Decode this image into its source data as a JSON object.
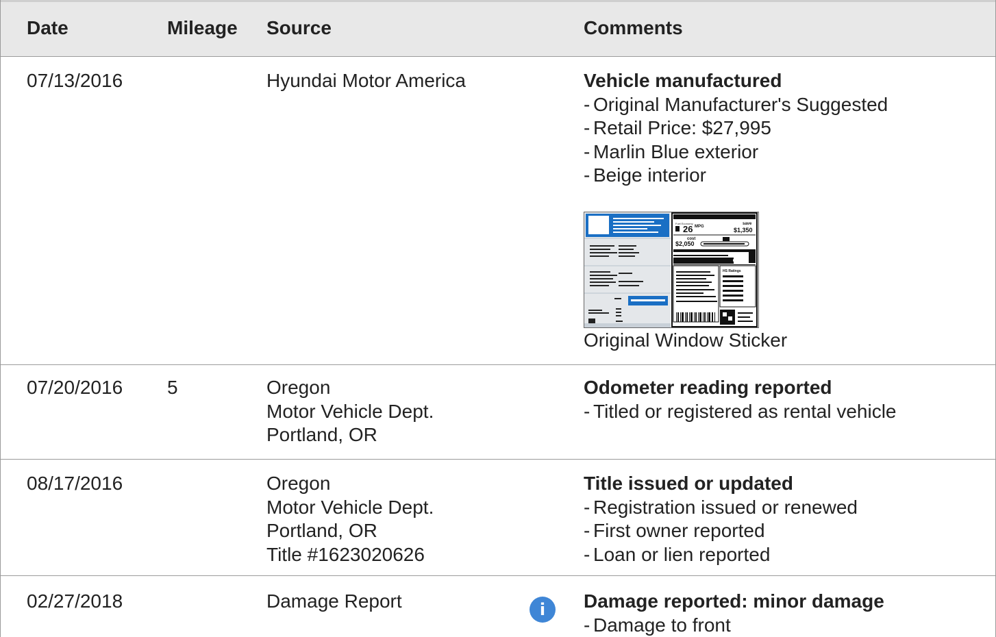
{
  "headers": {
    "date": "Date",
    "mileage": "Mileage",
    "source": "Source",
    "comments": "Comments"
  },
  "rows": [
    {
      "date": "07/13/2016",
      "mileage": "",
      "source": [
        "Hyundai Motor America"
      ],
      "title": "Vehicle manufactured",
      "bullets": [
        "Original Manufacturer's Suggested",
        "Retail Price: $27,995",
        "Marlin Blue exterior",
        "Beige interior"
      ],
      "sticker": {
        "caption": "Original Window Sticker",
        "mpg": "26",
        "mpg_unit": "MPG",
        "save_label": "save",
        "save_amount": "$1,350",
        "cost_label": "cost",
        "cost_amount": "$2,050",
        "ratings_label": "HS Ratings"
      }
    },
    {
      "date": "07/20/2016",
      "mileage": "5",
      "source": [
        "Oregon",
        "Motor Vehicle Dept.",
        "Portland, OR"
      ],
      "title": "Odometer reading reported",
      "bullets": [
        "Titled or registered as rental vehicle"
      ]
    },
    {
      "date": "08/17/2016",
      "mileage": "",
      "source": [
        "Oregon",
        "Motor Vehicle Dept.",
        "Portland, OR",
        "Title #1623020626"
      ],
      "title": "Title issued or updated",
      "bullets": [
        "Registration issued or renewed",
        "First owner reported",
        "Loan or lien reported"
      ]
    },
    {
      "date": "02/27/2018",
      "mileage": "",
      "source": [
        "Damage Report"
      ],
      "title": "Damage reported: minor damage",
      "bullets": [
        "Damage to front"
      ],
      "info_icon": "info-icon"
    }
  ],
  "colors": {
    "header_bg": "#e8e8e8",
    "border": "#9a9a9a",
    "info_icon": "#3f86d6",
    "sticker_blue": "#1a6fc4"
  }
}
